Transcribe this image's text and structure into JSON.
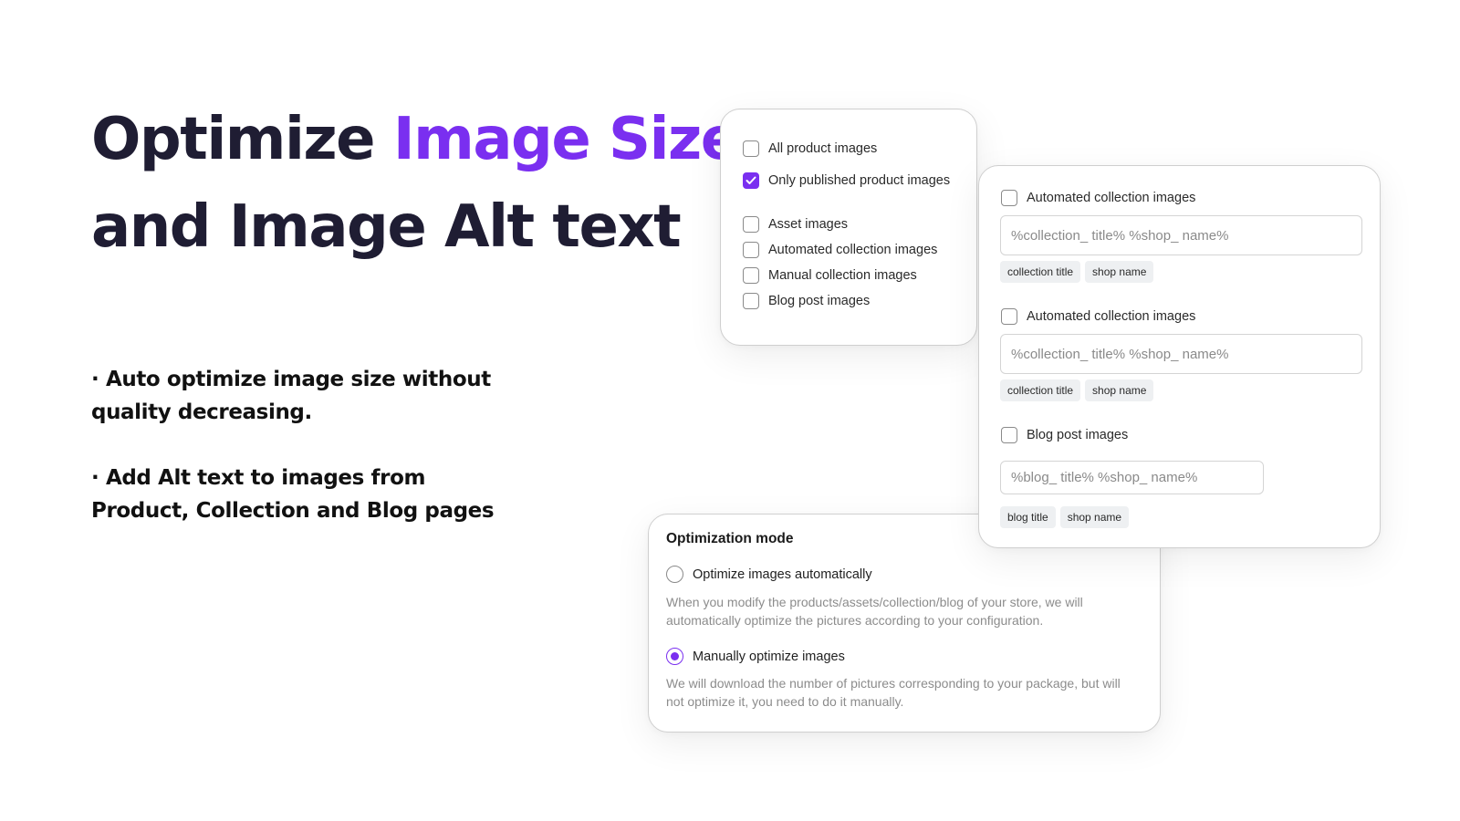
{
  "hero": {
    "title_line1_plain": "Optimize ",
    "title_line1_accent": "Image Size",
    "title_line2": "and Image Alt text",
    "bullets": [
      "· Auto optimize image size without quality decreasing.",
      "· Add Alt text to images from Product, Collection and Blog pages"
    ]
  },
  "colors": {
    "accent": "#7a2ff0",
    "title_dark": "#1f1d33",
    "muted_text": "#8c8c8c"
  },
  "scope_panel": {
    "options": [
      {
        "label": "All product images",
        "checked": false
      },
      {
        "label": "Only published product images",
        "checked": true
      },
      {
        "label": "Asset images",
        "checked": false
      },
      {
        "label": "Automated collection images",
        "checked": false
      },
      {
        "label": "Manual collection images",
        "checked": false
      },
      {
        "label": "Blog post images",
        "checked": false
      }
    ]
  },
  "alt_panel": {
    "sections": [
      {
        "label": "Automated collection images",
        "checked": false,
        "template_placeholder": "%collection_ title% %shop_ name%",
        "tags": [
          "collection title",
          "shop name"
        ]
      },
      {
        "label": "Automated collection images",
        "checked": false,
        "template_placeholder": "%collection_ title% %shop_ name%",
        "tags": [
          "collection title",
          "shop name"
        ]
      },
      {
        "label": "Blog post images",
        "checked": false,
        "template_placeholder": "%blog_ title% %shop_ name%",
        "tags": [
          "blog title",
          "shop name"
        ]
      }
    ]
  },
  "mode_panel": {
    "title": "Optimization mode",
    "options": [
      {
        "label": "Optimize images automatically",
        "selected": false,
        "description": "When you modify the products/assets/collection/blog of your store, we will automatically optimize the pictures according to your configuration."
      },
      {
        "label": "Manually optimize images",
        "selected": true,
        "description": "We will download the number of pictures corresponding to your package, but will not optimize it, you need to do it manually."
      }
    ]
  }
}
